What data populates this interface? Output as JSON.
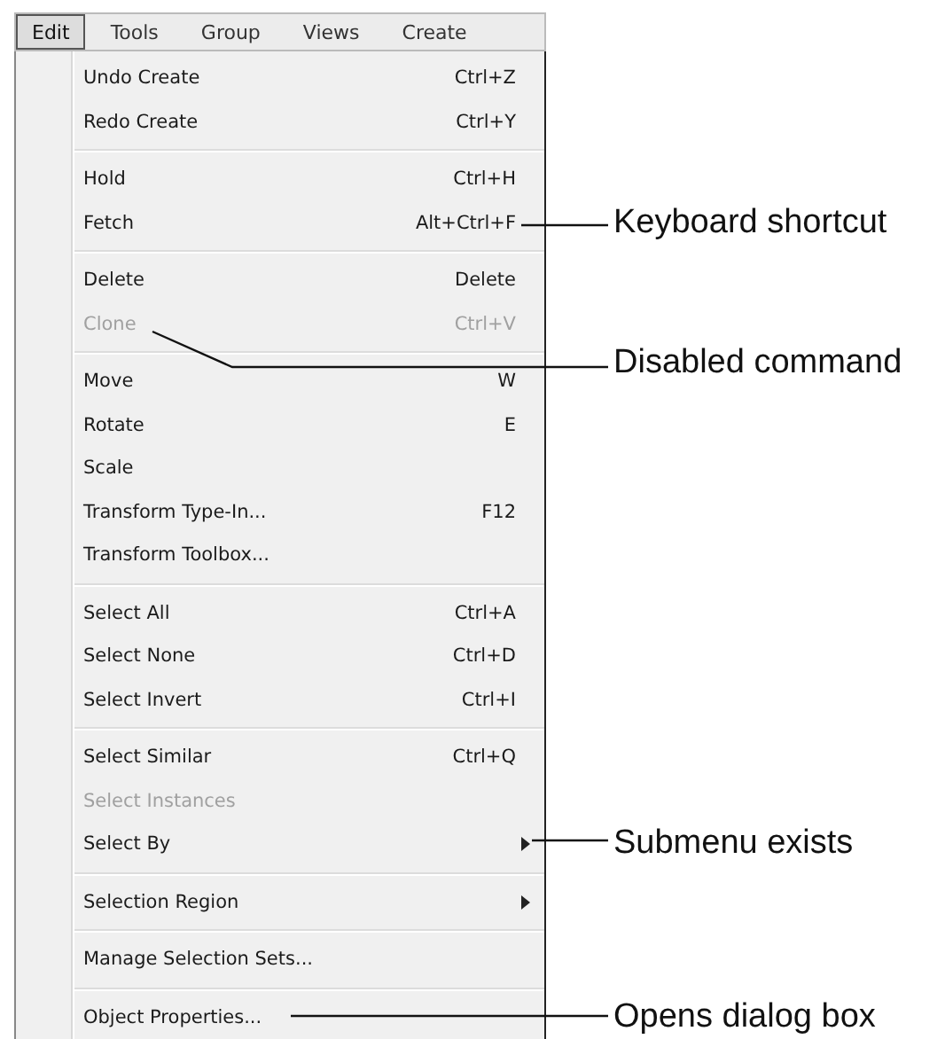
{
  "menubar": [
    {
      "label": "Edit",
      "selected": true
    },
    {
      "label": "Tools",
      "selected": false
    },
    {
      "label": "Group",
      "selected": false
    },
    {
      "label": "Views",
      "selected": false
    },
    {
      "label": "Create",
      "selected": false
    }
  ],
  "menu_groups": [
    {
      "items": [
        {
          "label": "Undo Create",
          "shortcut": "Ctrl+Z",
          "disabled": false
        },
        {
          "label": "Redo Create",
          "shortcut": "Ctrl+Y",
          "disabled": false
        }
      ]
    },
    {
      "items": [
        {
          "label": "Hold",
          "shortcut": "Ctrl+H",
          "disabled": false
        },
        {
          "label": "Fetch",
          "shortcut": "Alt+Ctrl+F",
          "disabled": false,
          "callout": "Keyboard shortcut"
        }
      ]
    },
    {
      "items": [
        {
          "label": "Delete",
          "shortcut": "Delete",
          "disabled": false
        },
        {
          "label": "Clone",
          "shortcut": "Ctrl+V",
          "disabled": true,
          "callout": "Disabled command"
        }
      ]
    },
    {
      "items": [
        {
          "label": "Move",
          "shortcut": "W",
          "disabled": false
        },
        {
          "label": "Rotate",
          "shortcut": "E",
          "disabled": false
        },
        {
          "label": "Scale",
          "disabled": false
        },
        {
          "label": "Transform Type-In...",
          "shortcut": "F12",
          "disabled": false
        },
        {
          "label": "Transform Toolbox...",
          "disabled": false
        }
      ]
    },
    {
      "items": [
        {
          "label": "Select All",
          "shortcut": "Ctrl+A",
          "disabled": false
        },
        {
          "label": "Select None",
          "shortcut": "Ctrl+D",
          "disabled": false
        },
        {
          "label": "Select Invert",
          "shortcut": "Ctrl+I",
          "disabled": false
        }
      ]
    },
    {
      "items": [
        {
          "label": "Select Similar",
          "shortcut": "Ctrl+Q",
          "disabled": false
        },
        {
          "label": "Select Instances",
          "disabled": true
        },
        {
          "label": "Select By",
          "disabled": false,
          "submenu": true,
          "callout": "Submenu exists"
        }
      ]
    },
    {
      "items": [
        {
          "label": "Selection Region",
          "disabled": false,
          "submenu": true
        }
      ]
    },
    {
      "items": [
        {
          "label": "Manage Selection Sets...",
          "disabled": false
        }
      ]
    },
    {
      "items": [
        {
          "label": "Object Properties...",
          "disabled": false,
          "callout": "Opens dialog box"
        }
      ]
    }
  ]
}
